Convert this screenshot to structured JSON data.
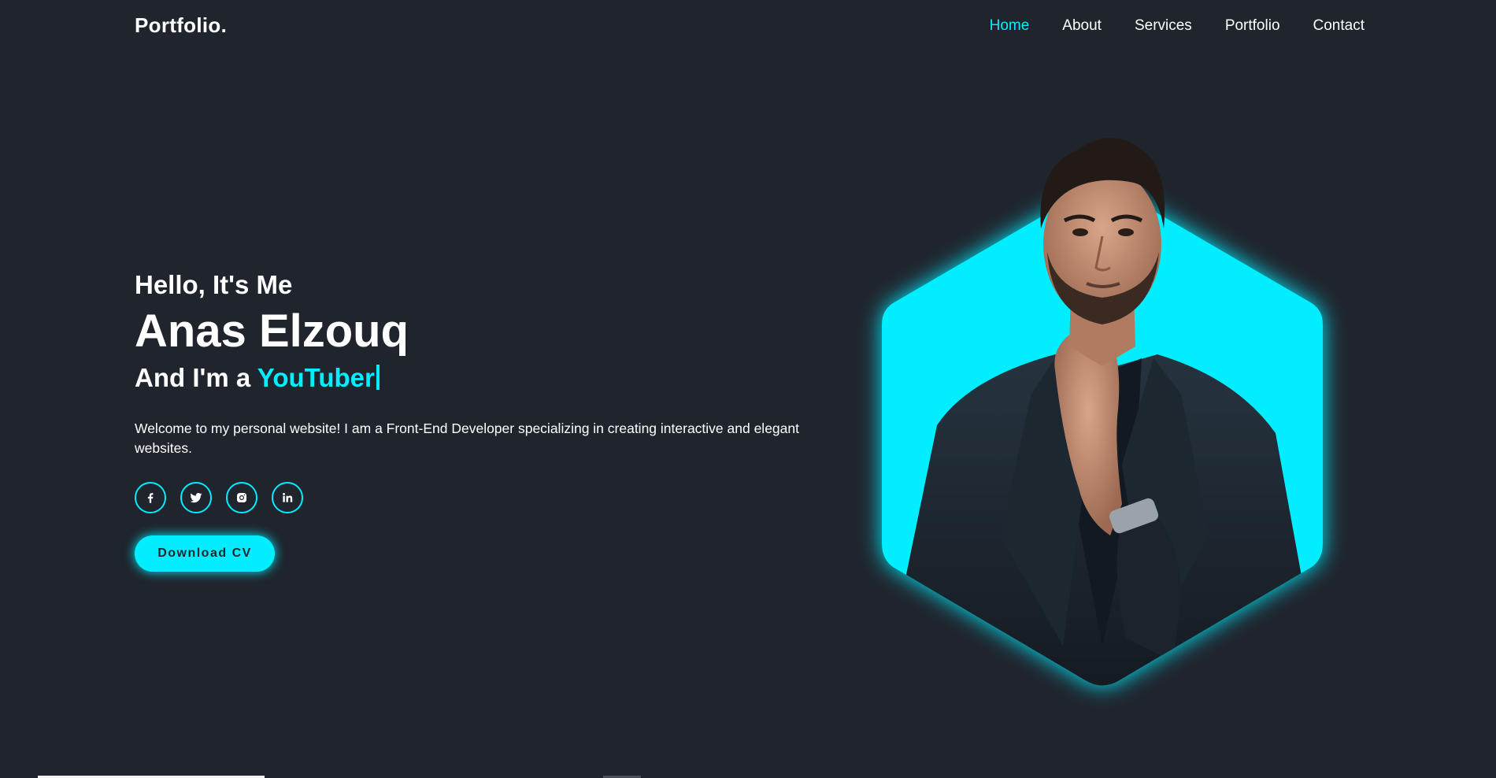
{
  "header": {
    "logo": "Portfolio.",
    "nav": [
      {
        "label": "Home",
        "active": true
      },
      {
        "label": "About",
        "active": false
      },
      {
        "label": "Services",
        "active": false
      },
      {
        "label": "Portfolio",
        "active": false
      },
      {
        "label": "Contact",
        "active": false
      }
    ]
  },
  "hero": {
    "greeting": "Hello, It's Me",
    "name": "Anas Elzouq",
    "role_prefix": "And I'm a ",
    "role_highlight": "YouTuber",
    "description": "Welcome to my personal website! I am a Front-End Developer specializing in creating interactive and elegant websites.",
    "socials": [
      {
        "icon": "facebook-icon",
        "glyph": "f"
      },
      {
        "icon": "twitter-icon",
        "glyph": "bird"
      },
      {
        "icon": "instagram-icon",
        "glyph": "camera"
      },
      {
        "icon": "linkedin-icon",
        "glyph": "in"
      }
    ],
    "cta_label": "Download CV"
  },
  "colors": {
    "background": "#1f242d",
    "accent": "#00eeff",
    "text": "#ffffff"
  }
}
